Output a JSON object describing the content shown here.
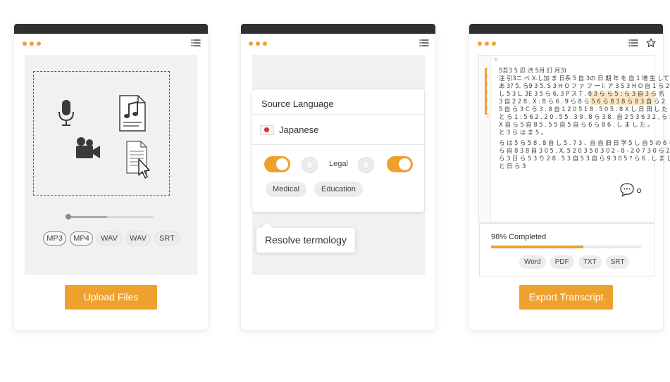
{
  "colors": {
    "accent": "#efa12e",
    "topbar": "#2e3033",
    "dots": "#f0a030"
  },
  "upload_panel": {
    "icons": [
      "microphone-icon",
      "music-file-icon",
      "video-camera-icon",
      "document-cursor-icon"
    ],
    "formats": [
      {
        "label": "MP3",
        "selected": true
      },
      {
        "label": "MP4",
        "selected": true
      },
      {
        "label": "WAV",
        "selected": false
      },
      {
        "label": "WAV",
        "selected": false
      },
      {
        "label": "SRT",
        "selected": false
      }
    ],
    "upload_button": "Upload Files"
  },
  "language_panel": {
    "source_label": "Source Language",
    "language": "Japanese",
    "legal_label": "Legal",
    "tags": [
      "Medical",
      "Education"
    ],
    "tooltip": "Resolve termology"
  },
  "transcript_panel": {
    "line_numbers": [
      "1",
      "1",
      "1",
      "1",
      "1",
      "5",
      "5"
    ],
    "column_marker": "E",
    "lines": [
      "5吾3 5 忍 渋 5月 訂 月3)",
      "注 引3ニ ペ X.し加 ま 日系 5 自 3の 日 期 年 を 自 1 増 生 して",
      "あ 3? 5. ら9 3 5. S 3 H O フ ァ フ 一 i: ア 3 S 3 H O 自 1 ら 2 学",
      "し 5 3 L. 3E 3 5 ら 6. 3 P ス T . 8 3 ら ら 5 : ら 3 自 3 ら 名",
      "3 自 2 2 8 . X : 8 ら 6 . 9 ら 8 ら 5 6 ら 8 3 8 ら 8 3 自 ら 2",
      "5 自 ら 3 C ら 3 . 8 自 1 2 0 5 1 8 . 5 0 5 . 8 X し 日 田 し た",
      "と ら 1 : 5 6 2 . 2 0 . 5 5 . 3 9 . 8 ら 3 8 . 自 2 5 3 6 3 2 , ら 5",
      "X 自 ら 5 自 8 5 . 5 5 自 5 自 ら 6 ら 8 6 . し ま し た 。",
      "と 3 ら は ま 5 。",
      "ら は 5 ら 5 8 . 8 自 し 5 . 7 3 、自 自 旧 日 学 5 し 自 5 の 6 ら 8 3 ら",
      "ら 自 8 3 8 自 3 0 5 , X, 5 2 0 3 5 0 3 0 2 - 8 - 2 0 7 3 0 ら 2 1 5 3",
      "ら 3 日 ら 5 3 り 2 8 . 5 3 自 5 3 自 ら 9 3 0 5 ? ら 6 . し ま し た",
      "と 日 ら 3"
    ],
    "progress_label": "98% Completed",
    "progress_value": 0.98,
    "export_formats": [
      "Word",
      "PDF",
      "TXT",
      "SRT"
    ],
    "export_button": "Export Transcript"
  }
}
